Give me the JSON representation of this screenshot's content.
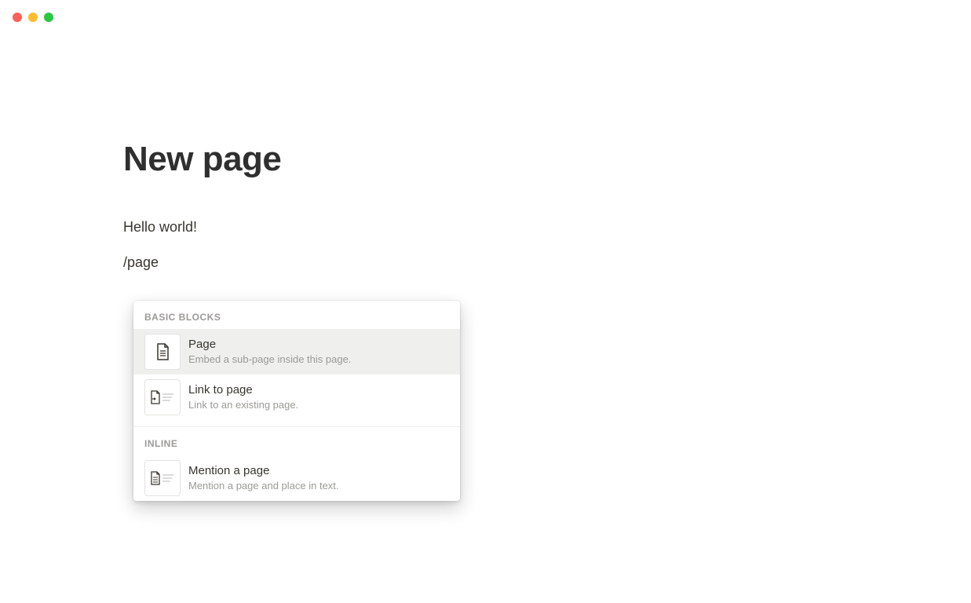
{
  "page": {
    "title": "New page",
    "text_block": "Hello world!",
    "slash_input": "/page"
  },
  "menu": {
    "sections": [
      {
        "header": "BASIC BLOCKS",
        "items": [
          {
            "title": "Page",
            "description": "Embed a sub-page inside this page.",
            "selected": true
          },
          {
            "title": "Link to page",
            "description": "Link to an existing page.",
            "selected": false
          }
        ]
      },
      {
        "header": "INLINE",
        "items": [
          {
            "title": "Mention a page",
            "description": "Mention a page and place in text.",
            "selected": false
          }
        ]
      }
    ]
  }
}
